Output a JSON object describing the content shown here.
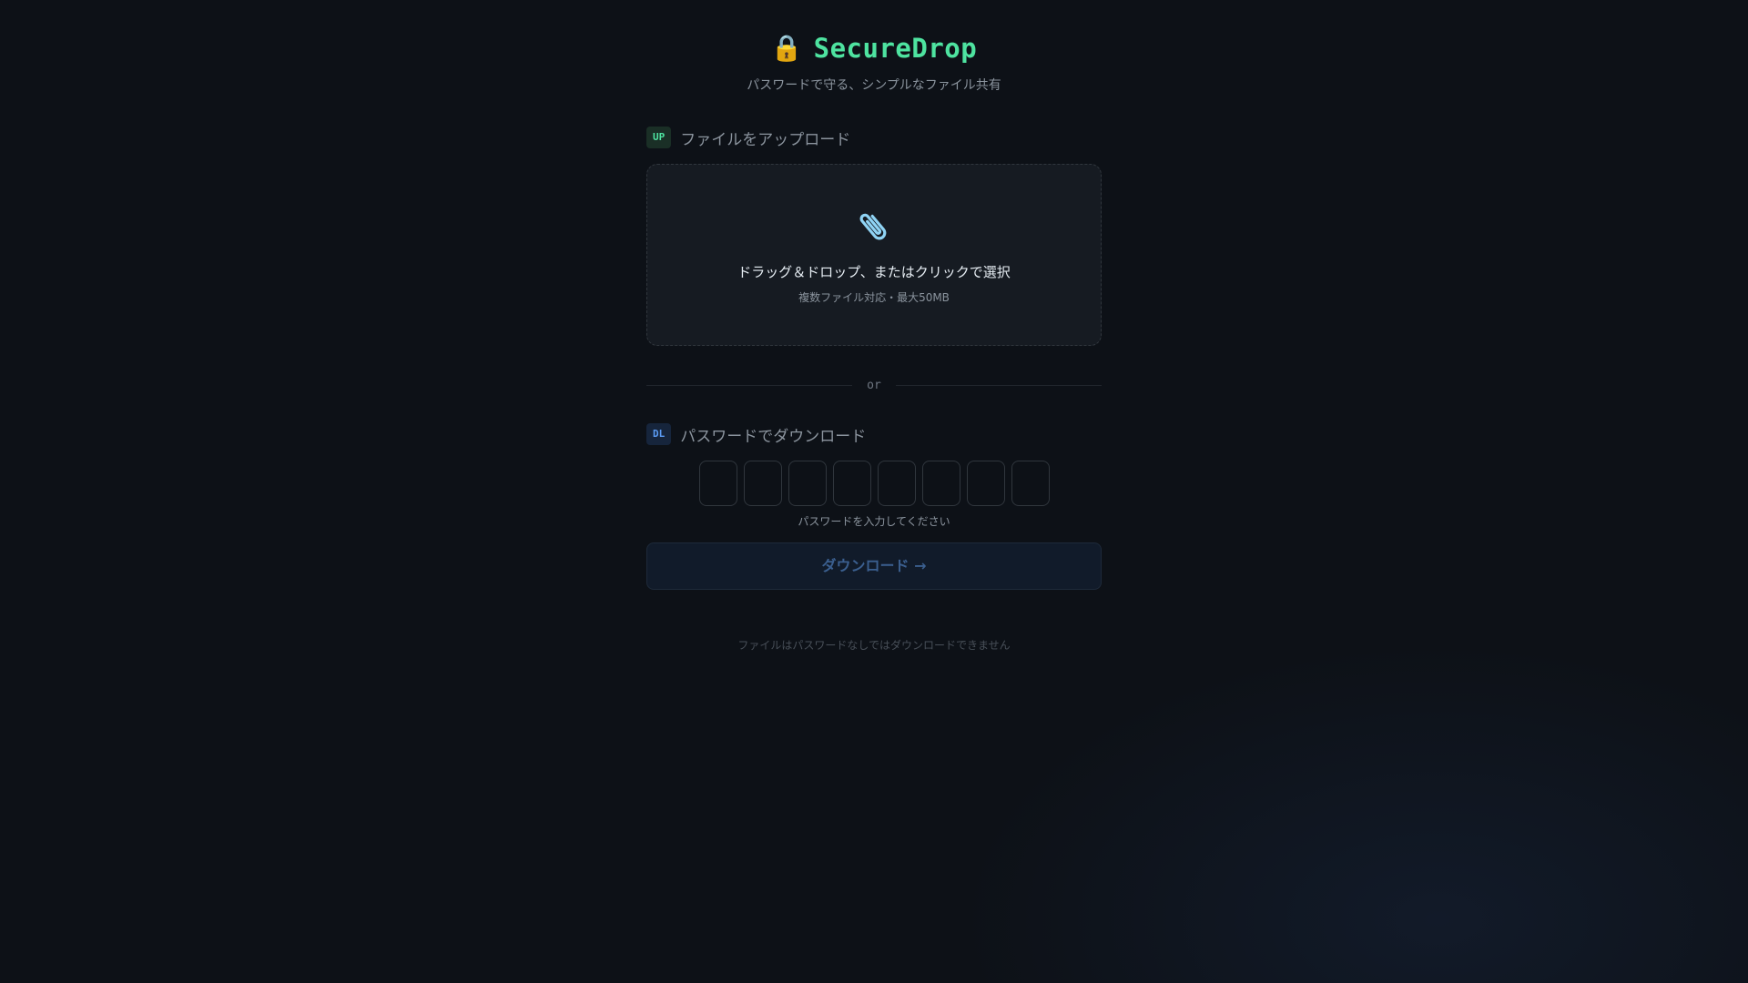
{
  "header": {
    "lock_icon": "🔒",
    "title": "SecureDrop",
    "subtitle": "パスワードで守る、シンプルなファイル共有"
  },
  "upload": {
    "badge": "UP",
    "title": "ファイルをアップロード",
    "icon": "paperclip-icon",
    "drop_text": "ドラッグ＆ドロップ、またはクリックで選択",
    "drop_hint": "複数ファイル対応・最大50MB"
  },
  "divider": {
    "text": "or"
  },
  "download": {
    "badge": "DL",
    "title": "パスワードでダウンロード",
    "pin_values": [
      "",
      "",
      "",
      "",
      "",
      "",
      "",
      ""
    ],
    "hint": "パスワードを入力してください",
    "button_label": "ダウンロード →"
  },
  "footer": {
    "note": "ファイルはパスワードなしではダウンロードできません"
  },
  "colors": {
    "background": "#0d1117",
    "accent_green": "#4ee3a0",
    "accent_blue": "#5b9cf5"
  }
}
